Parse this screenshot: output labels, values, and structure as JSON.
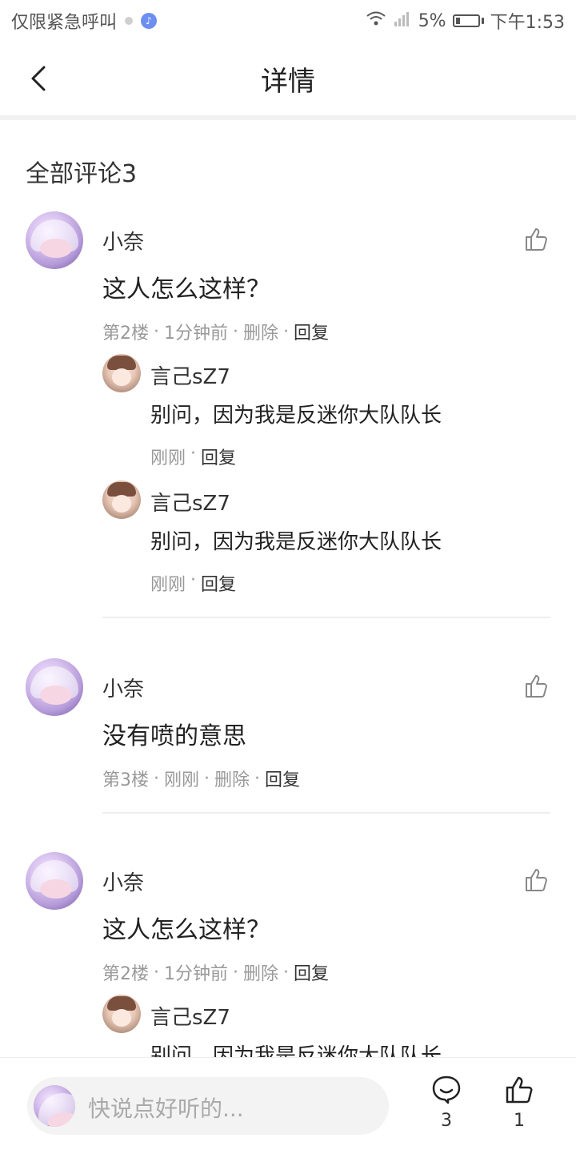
{
  "status_bar": {
    "left_text": "仅限紧急呼叫",
    "battery": "5%",
    "time": "下午1:53"
  },
  "header": {
    "title": "详情"
  },
  "comments_section": {
    "title": "全部评论3",
    "comments": [
      {
        "author": "小奈",
        "text": "这人怎么这样？",
        "floor": "第2楼",
        "time": "1分钟前",
        "delete": "删除",
        "reply": "回复",
        "replies": [
          {
            "author": "言己sZ7",
            "text": "别问，因为我是反迷你大队队长",
            "time": "刚刚",
            "reply": "回复"
          },
          {
            "author": "言己sZ7",
            "text": "别问，因为我是反迷你大队队长",
            "time": "刚刚",
            "reply": "回复"
          }
        ]
      },
      {
        "author": "小奈",
        "text": "没有喷的意思",
        "floor": "第3楼",
        "time": "刚刚",
        "delete": "删除",
        "reply": "回复",
        "replies": []
      },
      {
        "author": "小奈",
        "text": "这人怎么这样？",
        "floor": "第2楼",
        "time": "1分钟前",
        "delete": "删除",
        "reply": "回复",
        "replies": [
          {
            "author": "言己sZ7",
            "text": "别问，因为我是反迷你大队队长"
          }
        ]
      }
    ]
  },
  "bottom_bar": {
    "placeholder": "快说点好听的...",
    "comment_count": "3",
    "like_count": "1"
  },
  "icons": {
    "back": "back-arrow-icon",
    "like": "thumbs-up-icon",
    "comment": "comment-bubble-icon"
  },
  "colors": {
    "text_primary": "#222222",
    "text_secondary": "#999999",
    "divider": "#eeeeee",
    "input_bg": "#f3f3f3"
  }
}
